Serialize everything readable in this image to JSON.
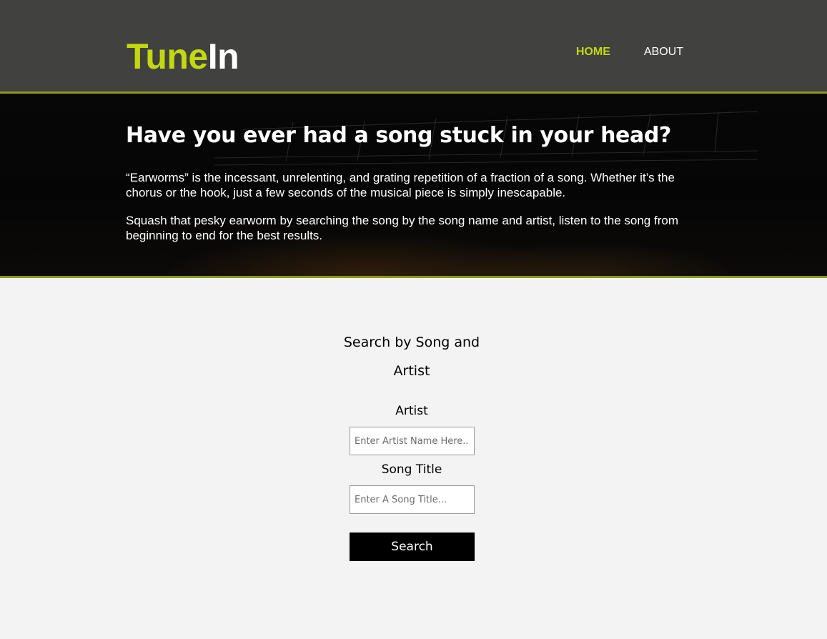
{
  "header": {
    "logo_part1": "Tune",
    "logo_part2": "In",
    "nav": [
      {
        "label": "HOME",
        "active": true
      },
      {
        "label": "ABOUT",
        "active": false
      }
    ]
  },
  "hero": {
    "title": "Have you ever had a song stuck in your head?",
    "paragraph1": "“Earworms” is the incessant, unrelenting, and grating repetition of a fraction of a song. Whether it’s the chorus or the hook, just a few seconds of the musical piece is simply inescapable.",
    "paragraph2": "Squash that pesky earworm by searching the song by the song name and artist, listen to the song from beginning to end for the best results."
  },
  "search": {
    "heading": "Search by Song and Artist",
    "artist_label": "Artist",
    "artist_placeholder": "Enter Artist Name Here...",
    "song_label": "Song Title",
    "song_placeholder": "Enter A Song Title...",
    "button_label": "Search"
  },
  "colors": {
    "accent": "#c2d80f",
    "header_bg": "#41413f",
    "border": "#8a9a14",
    "page_bg": "#f3f3f3"
  }
}
